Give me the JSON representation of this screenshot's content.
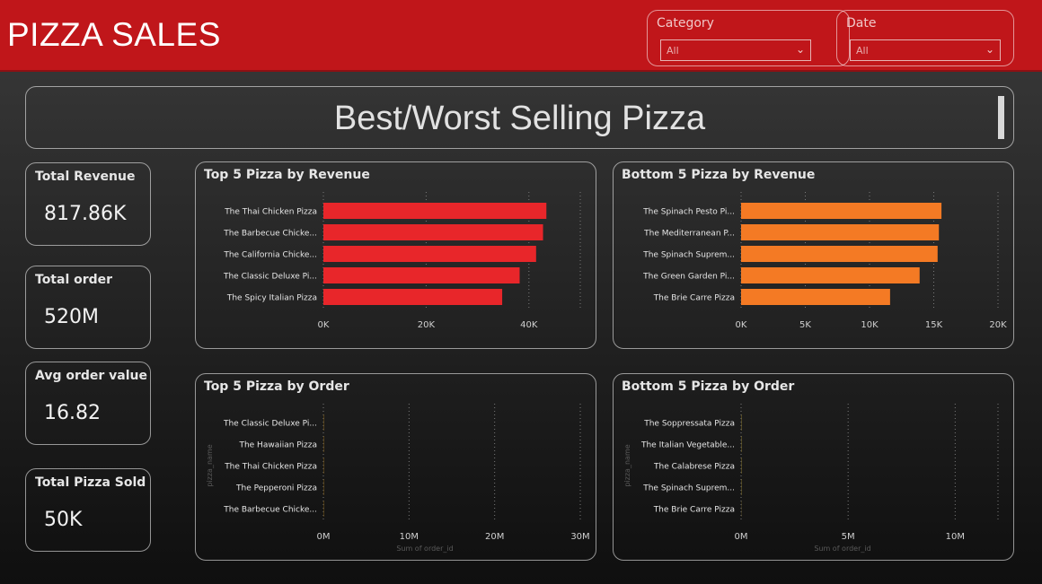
{
  "app": {
    "title": "PIZZA SALES"
  },
  "filters": [
    {
      "label": "Category",
      "value": "All"
    },
    {
      "label": "Date",
      "value": "All"
    }
  ],
  "banner": {
    "title": "Best/Worst Selling Pizza"
  },
  "kpis": [
    {
      "label": "Total Revenue",
      "value": "817.86K"
    },
    {
      "label": "Total order",
      "value": "520M"
    },
    {
      "label": "Avg order value",
      "value": "16.82"
    },
    {
      "label": "Total Pizza Sold",
      "value": "50K"
    }
  ],
  "colors": {
    "header": "#c0161a",
    "top_revenue_bar": "#e8262a",
    "bottom_revenue_bar": "#f47a24",
    "top_order_bar": "#f0a40c",
    "bottom_order_bar": "#f6cf3a"
  },
  "chart_data": [
    {
      "type": "bar",
      "orientation": "horizontal",
      "title": "Top 5 Pizza by Revenue",
      "categories": [
        "The Thai Chicken Pizza",
        "The Barbecue Chicke...",
        "The California Chicke...",
        "The Classic Deluxe Pi...",
        "The Spicy Italian Pizza"
      ],
      "values": [
        43400,
        42750,
        41400,
        38200,
        34800
      ],
      "xlim": [
        0,
        50000
      ],
      "ticks": [
        0,
        20000,
        40000
      ],
      "tick_labels": [
        "0K",
        "20K",
        "40K"
      ],
      "xlabel": "",
      "ylabel": ""
    },
    {
      "type": "bar",
      "orientation": "horizontal",
      "title": "Bottom 5 Pizza by Revenue",
      "categories": [
        "The Spinach Pesto Pi...",
        "The Mediterranean P...",
        "The Spinach Suprem...",
        "The Green Garden Pi...",
        "The Brie Carre Pizza"
      ],
      "values": [
        15600,
        15400,
        15300,
        13900,
        11600
      ],
      "xlim": [
        0,
        20000
      ],
      "ticks": [
        0,
        5000,
        10000,
        15000,
        20000
      ],
      "tick_labels": [
        "0K",
        "5K",
        "10K",
        "15K",
        "20K"
      ],
      "xlabel": "",
      "ylabel": ""
    },
    {
      "type": "bar",
      "orientation": "horizontal",
      "title": "Top 5 Pizza by Order",
      "categories": [
        "The Classic Deluxe Pi...",
        "The Hawaiian Pizza",
        "The Thai Chicken Pizza",
        "The Pepperoni Pizza",
        "The Barbecue Chicke..."
      ],
      "values": [
        26400,
        25800,
        25300,
        25200,
        25000
      ],
      "xlim": [
        0,
        30000000
      ],
      "ticks": [
        0,
        10000000,
        20000000,
        30000000
      ],
      "tick_labels": [
        "0M",
        "10M",
        "20M",
        "30M"
      ],
      "xlabel": "Sum of order_id",
      "ylabel": "pizza_name"
    },
    {
      "type": "bar",
      "orientation": "horizontal",
      "title": "Bottom 5 Pizza by Order",
      "categories": [
        "The Soppressata Pizza",
        "The Italian Vegetable...",
        "The Calabrese Pizza",
        "The Spinach Suprem...",
        "The Brie Carre Pizza"
      ],
      "values": [
        10100,
        10100,
        10000,
        9900,
        5200
      ],
      "xlim": [
        0,
        12000000
      ],
      "ticks": [
        0,
        5000000,
        10000000
      ],
      "tick_labels": [
        "0M",
        "5M",
        "10M"
      ],
      "xlabel": "Sum of order_id",
      "ylabel": "pizza_name"
    }
  ]
}
